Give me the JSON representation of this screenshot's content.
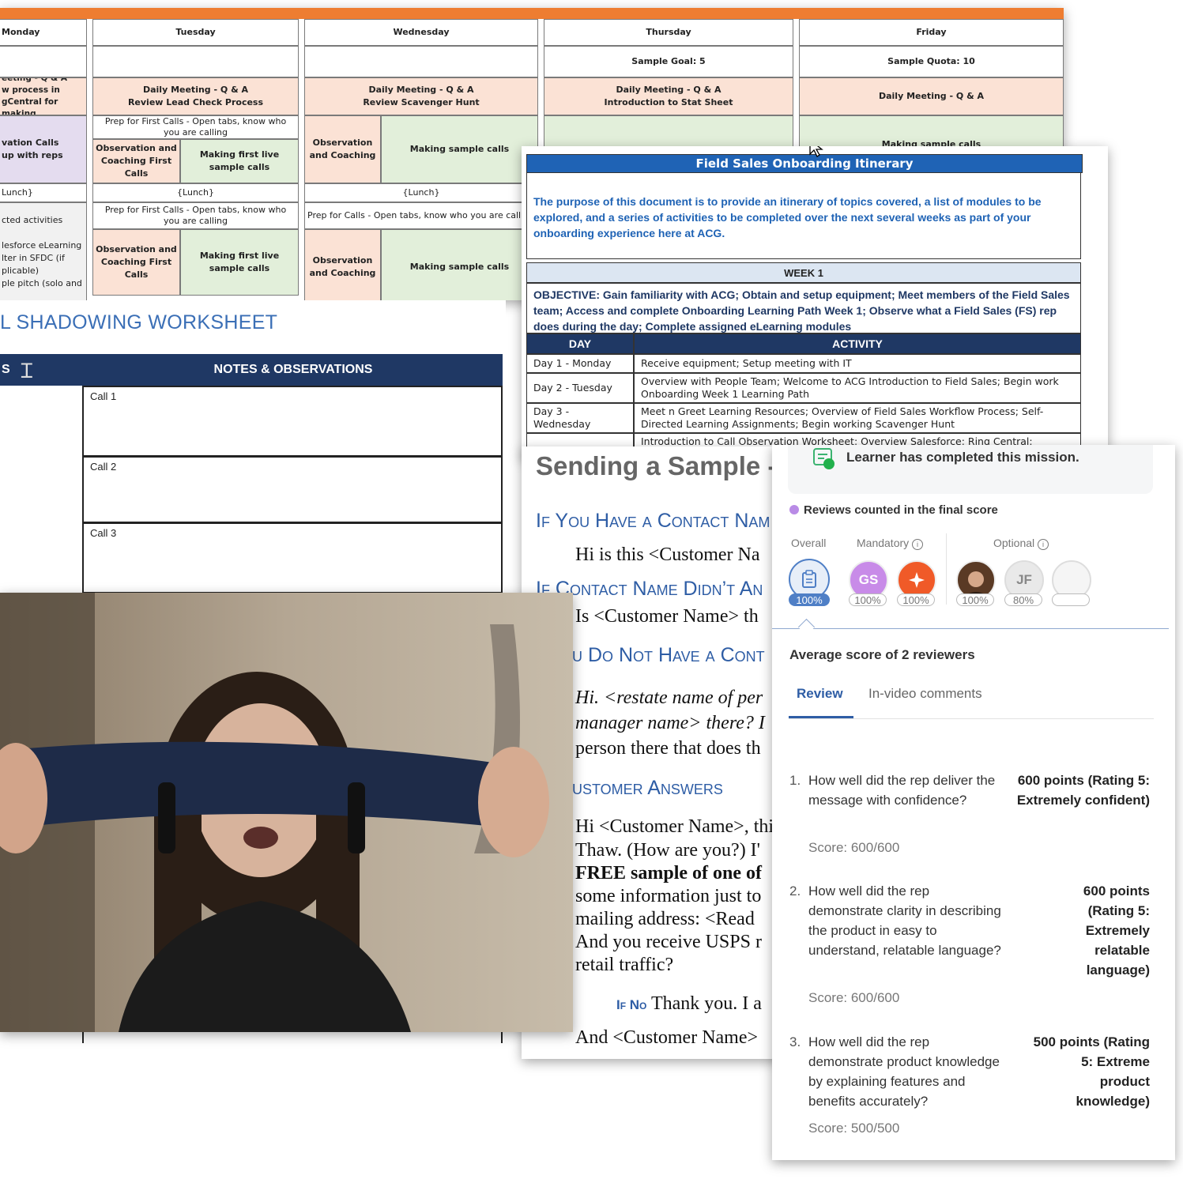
{
  "schedule": {
    "days": [
      "Monday",
      "Tuesday",
      "Wednesday",
      "Thursday",
      "Friday"
    ],
    "goal_thursday": "Sample Goal: 5",
    "quota_friday": "Sample Quota: 10",
    "mon_meeting": "eeting - Q & A\nw process in\ngCentral for making",
    "tue_meeting": "Daily Meeting - Q & A\nReview Lead Check Process",
    "wed_meeting": "Daily Meeting - Q & A\nReview Scavenger Hunt",
    "thu_meeting": "Daily Meeting - Q & A\nIntroduction to Stat Sheet",
    "fri_meeting": "Daily Meeting - Q & A",
    "mon_obs": "vation Calls\nup with reps",
    "prep_first": "Prep for First Calls - Open tabs, know who you are calling",
    "obs_first": "Observation and Coaching First Calls",
    "making_first": "Making first live sample calls",
    "obs_coach": "Observation and Coaching",
    "making_sample": "Making sample calls",
    "fri_making": "Making sample calls",
    "lunch": "{Lunch}",
    "mon_lunch": "Lunch}",
    "mon_pm": "cted activities\n\nlesforce eLearning\nlter in SFDC (if\nplicable)\nple pitch (solo and",
    "prep_calls": "Prep for  Calls - Open tabs, know who you are calli"
  },
  "worksheet": {
    "title": "L SHADOWING WORKSHEET",
    "left_header": "S",
    "notes_header": "NOTES & OBSERVATIONS",
    "calls": [
      "Call 1",
      "Call 2",
      "Call 3"
    ]
  },
  "itinerary": {
    "title": "Field Sales Onboarding Itinerary",
    "purpose": "The purpose of this document is to provide an itinerary of topics covered, a list of modules to be explored, and a series of activities to be completed over the next several weeks as part of your onboarding experience here at ACG.",
    "week": "WEEK 1",
    "objective": "OBJECTIVE: Gain familiarity with ACG; Obtain and setup equipment; Meet members of the Field Sales team; Access and complete Onboarding Learning Path Week 1; Observe what a Field Sales (FS) rep does during the day; Complete assigned eLearning modules",
    "col_day": "DAY",
    "col_activity": "ACTIVITY",
    "rows": [
      {
        "day": "Day 1 - Monday",
        "activity": "Receive equipment; Setup meeting with IT"
      },
      {
        "day": "Day 2 - Tuesday",
        "activity": "Overview with People Team; Welcome to ACG Introduction to Field Sales; Begin work Onboarding Week 1 Learning Path"
      },
      {
        "day": "Day 3 - Wednesday",
        "activity": "Meet n Greet Learning Resources; Overview of Field Sales Workflow Process; Self-Directed Learning Assignments; Begin working Scavenger Hunt"
      },
      {
        "day": "",
        "activity": "Introduction to Call Observation Worksheet; Overview Salesforce; Ring Central; Continue"
      }
    ]
  },
  "script": {
    "title": "Sending a Sample -",
    "h_contact": "If You Have a Contact Nam",
    "p_contact": "Hi is this <Customer Na",
    "h_didnt": "If Contact Name Didn’t An",
    "p_didnt": "Is <Customer Name> th",
    "h_nocontact": "u Do Not Have a Cont",
    "p_no1": "Hi. <restate name of per",
    "p_no2": "manager name> there? I",
    "p_no3": "person there that does th",
    "h_answers": "ustomer Answers",
    "p_a1": "Hi <Customer Name>, this",
    "p_a2": "Thaw. (How are you?) I'",
    "p_a3": "FREE sample of one of",
    "p_a4": "some information just to",
    "p_a5": "mailing address: <Read",
    "p_a6": "And you receive USPS r",
    "p_a7": "retail traffic?",
    "if_no_label": "If No",
    "if_no_text": "Thank you. I a",
    "p_last": "And <Customer Name>"
  },
  "review": {
    "completed": "Learner has completed this mission.",
    "legend": "Reviews counted in the final score",
    "overall_label": "Overall",
    "mandatory_label": "Mandatory",
    "optional_label": "Optional",
    "overall_pct": "100%",
    "reviewers": [
      {
        "initials": "GS",
        "pct": "100%",
        "color": "#c88be8"
      },
      {
        "initials": "",
        "pct": "100%",
        "color": "#f05a28"
      },
      {
        "initials": "",
        "pct": "100%",
        "color": "#5a3a25"
      },
      {
        "initials": "JF",
        "pct": "80%",
        "color": "#e9e9e9"
      },
      {
        "initials": "",
        "pct": "",
        "color": "#f3f3f3"
      }
    ],
    "average": "Average score of 2 reviewers",
    "tab_review": "Review",
    "tab_comments": "In-video comments",
    "questions": [
      {
        "num": "1.",
        "text": "How well did the rep deliver the message with confidence?",
        "points": "600 points (Rating 5: Extremely confident)",
        "score": "Score: 600/600"
      },
      {
        "num": "2.",
        "text": "How well did the rep demonstrate clarity in describing the product in easy to understand, relatable language?",
        "points": "600 points (Rating 5: Extremely relatable language)",
        "score": "Score: 600/600"
      },
      {
        "num": "3.",
        "text": "How well did the rep demonstrate product knowledge by explaining features and benefits accurately?",
        "points": "500 points (Rating 5: Extreme product knowledge)",
        "score": "Score: 500/500"
      }
    ]
  }
}
